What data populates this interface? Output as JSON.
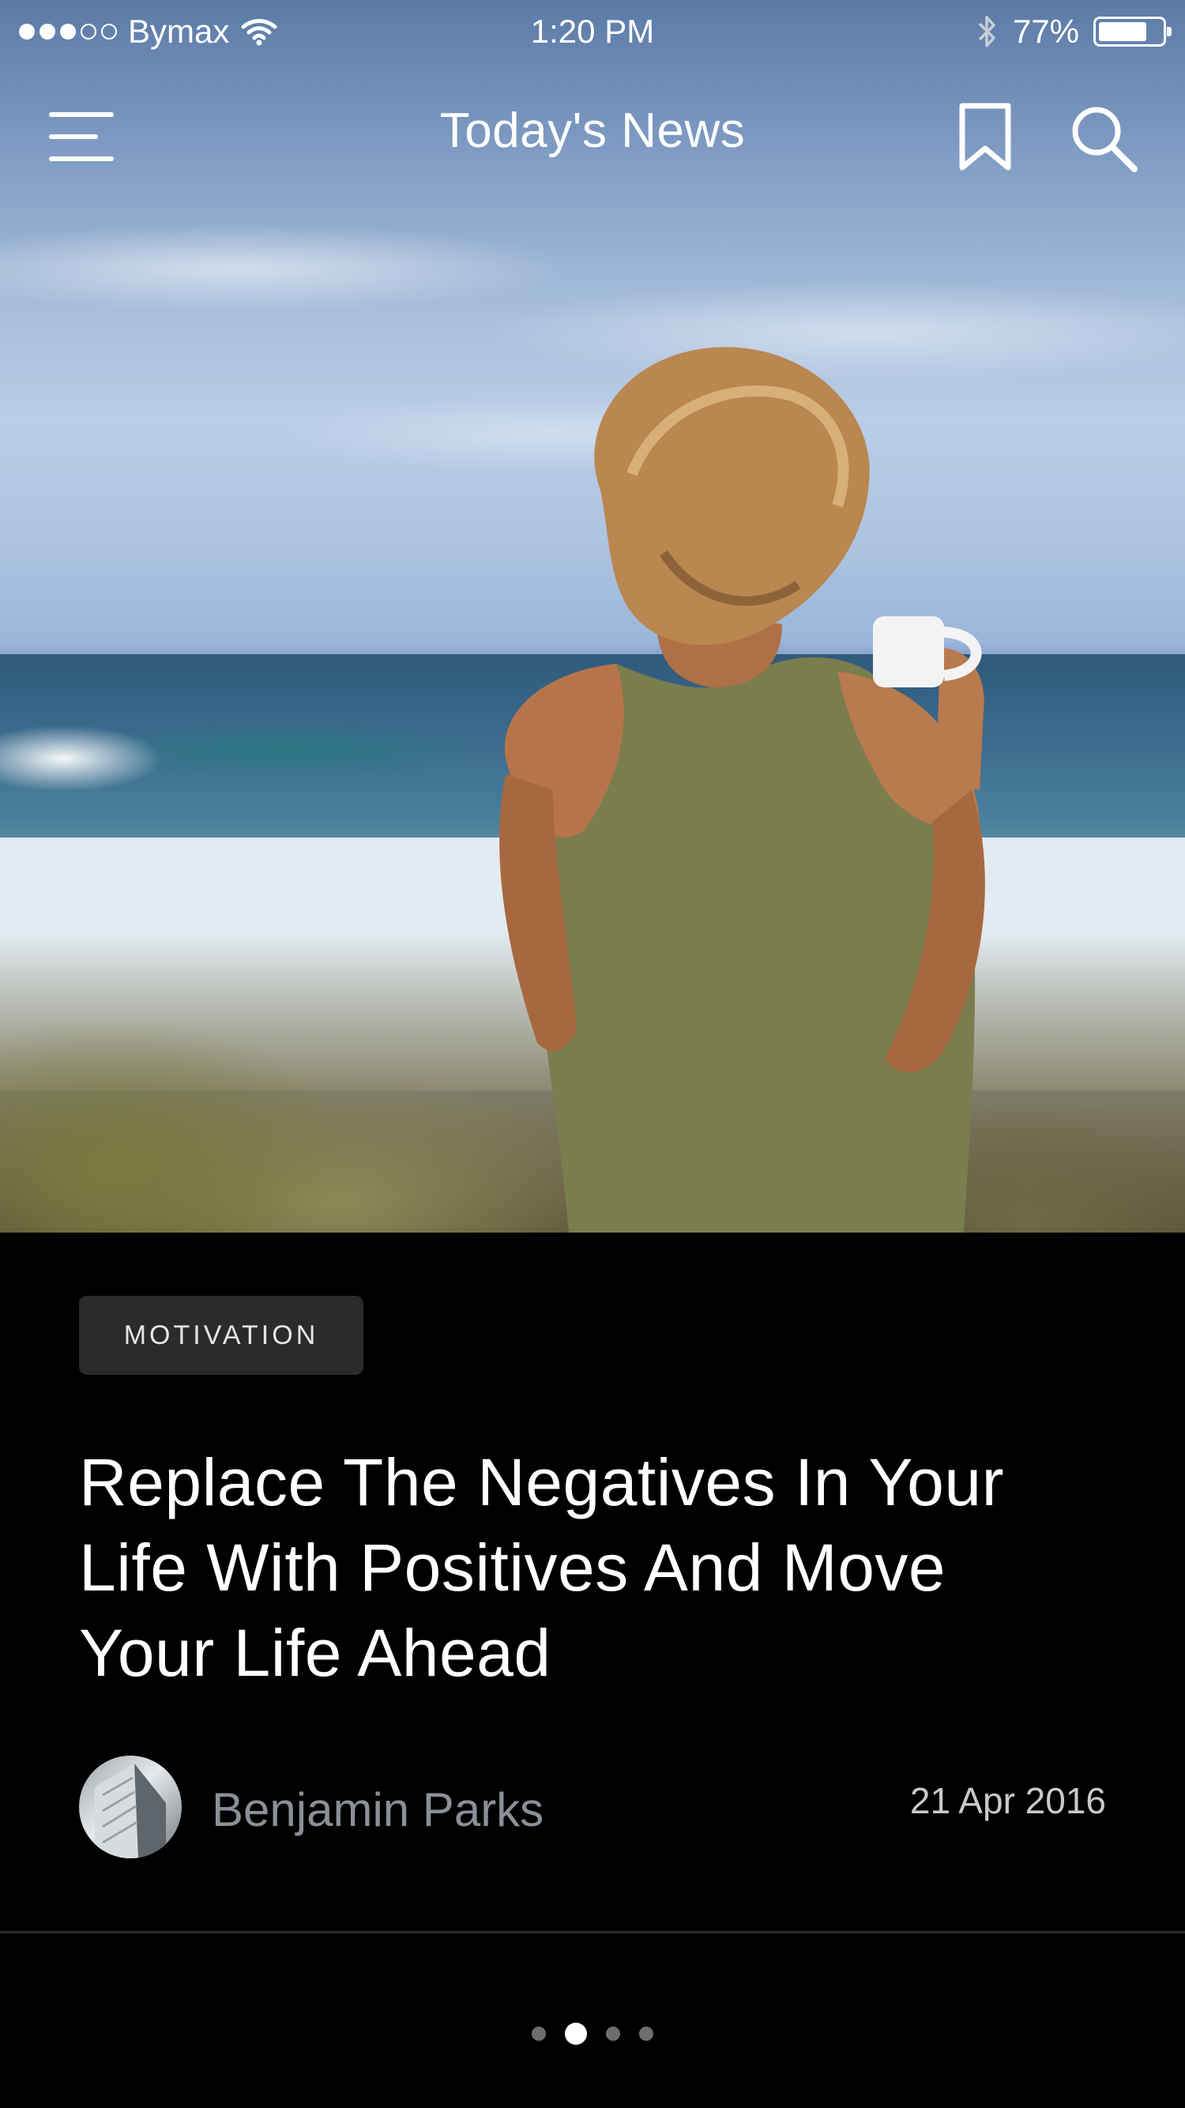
{
  "status_bar": {
    "carrier": "Bymax",
    "time": "1:20 PM",
    "battery_percent_label": "77%",
    "battery_level": 0.77,
    "signal_filled": 3,
    "signal_total": 5
  },
  "nav": {
    "title": "Today's News",
    "menu_icon": "hamburger-menu-icon",
    "bookmark_icon": "bookmark-icon",
    "search_icon": "search-icon"
  },
  "article": {
    "category": "MOTIVATION",
    "headline_lines": [
      "Replace The Negatives In Your",
      "Life With Positives And Move",
      "Your Life Ahead"
    ],
    "author": "Benjamin Parks",
    "date": "21 Apr 2016"
  },
  "pager": {
    "count": 4,
    "active_index": 1
  },
  "colors": {
    "background": "#000000",
    "tag_bg": "#2b2b2e",
    "author_text": "#8b8f97",
    "date_text": "#c7c9cd"
  }
}
